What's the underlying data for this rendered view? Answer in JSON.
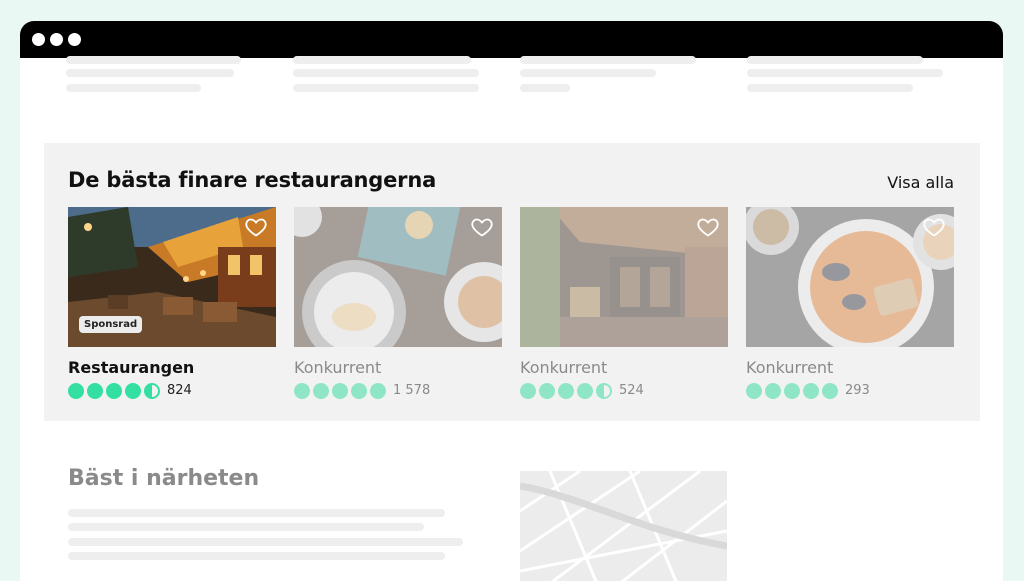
{
  "featured": {
    "title": "De bästa finare restaurangerna",
    "view_all_label": "Visa alla",
    "cards": [
      {
        "name": "Restaurangen",
        "badge": "Sponsrad",
        "rating": 4.5,
        "reviews": "824",
        "variant": "own"
      },
      {
        "name": "Konkurrent",
        "rating": 5,
        "reviews": "1 578",
        "variant": "competitor"
      },
      {
        "name": "Konkurrent",
        "rating": 4.5,
        "reviews": "524",
        "variant": "competitor"
      },
      {
        "name": "Konkurrent",
        "rating": 5,
        "reviews": "293",
        "variant": "competitor"
      }
    ]
  },
  "nearby": {
    "title": "Bäst i närheten"
  },
  "colors": {
    "bubble_own": "#34e0a1",
    "bubble_competitor": "#8fe6c6",
    "background": "#eaf8f3"
  },
  "icons": [
    "heart-icon",
    "window-dot-icon"
  ]
}
